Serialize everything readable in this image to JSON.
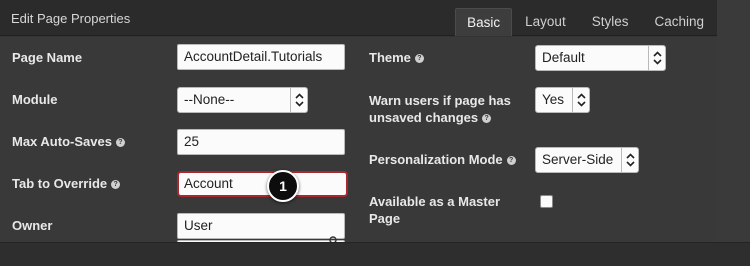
{
  "header": {
    "title": "Edit Page Properties",
    "tabs": [
      {
        "label": "Basic",
        "active": true
      },
      {
        "label": "Layout",
        "active": false
      },
      {
        "label": "Styles",
        "active": false
      },
      {
        "label": "Caching",
        "active": false
      }
    ]
  },
  "left": {
    "page_name": {
      "label": "Page Name",
      "value": "AccountDetail.Tutorials"
    },
    "module": {
      "label": "Module",
      "value": "--None--"
    },
    "max_auto_saves": {
      "label": "Max Auto-Saves",
      "help": "?",
      "value": "25"
    },
    "tab_to_override": {
      "label": "Tab to Override",
      "help": "?",
      "value": "Account"
    },
    "owner": {
      "label": "Owner",
      "value": "User"
    }
  },
  "right": {
    "theme": {
      "label": "Theme",
      "help": "?",
      "value": "Default"
    },
    "warn_unsaved": {
      "label_line1": "Warn users if page has",
      "label_line2": "unsaved changes",
      "help": "?",
      "value": "Yes"
    },
    "personalization": {
      "label": "Personalization Mode",
      "help": "?",
      "value": "Server-Side"
    },
    "master_page": {
      "label_line1": "Available as a Master",
      "label_line2": "Page",
      "checked": false
    }
  },
  "marker": {
    "number": "1"
  },
  "icons": {
    "select_arrows": "up-down-chevron-icon",
    "search": "search-icon",
    "help": "question-circle-icon"
  },
  "colors": {
    "highlight_border": "#a8282f",
    "marker_bg": "#0d0d0d"
  }
}
